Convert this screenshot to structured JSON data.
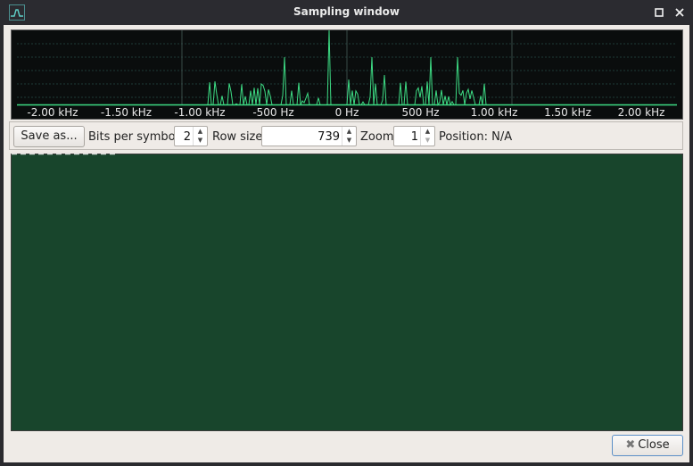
{
  "window": {
    "title": "Sampling window"
  },
  "spectrum": {
    "freq_labels": [
      "-2.00 kHz",
      "-1.50 kHz",
      "-1.00 kHz",
      "-500 Hz",
      "0 Hz",
      "500 Hz",
      "1.00 kHz",
      "1.50 kHz",
      "2.00 kHz"
    ]
  },
  "toolbar": {
    "save_label": "Save as...",
    "bits_label": "Bits per symbol",
    "bits_value": "2",
    "rowsize_label": "Row size",
    "rowsize_value": "739",
    "zoom_label": "Zoom",
    "zoom_value": "1",
    "position_text": "Position: N/A"
  },
  "footer": {
    "close_label": "Close"
  },
  "colors": {
    "spectrum_line": "#3ddc84",
    "canvas_bg": "#18452c",
    "client_bg": "#efebe7"
  }
}
